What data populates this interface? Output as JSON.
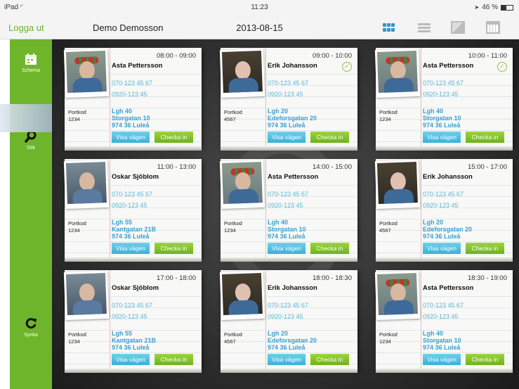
{
  "statusbar": {
    "device": "iPad",
    "wifi": "◜",
    "time": "11:23",
    "battery": "46 %",
    "battery_level": 0.46,
    "location": "➤"
  },
  "navbar": {
    "logout": "Logga ut",
    "user": "Demo Demosson",
    "date": "2013-08-15"
  },
  "sidebar": {
    "schema": "Schema",
    "search": "Sök",
    "sync": "Synka"
  },
  "colors": {
    "accent_green": "#6fb52c",
    "link_blue": "#3aa0cf",
    "route_btn": "#39b2d9",
    "checkin_btn": "#6db21f"
  },
  "cards": [
    {
      "time": "08:00 - 09:00",
      "name": "Asta Pettersson",
      "phone1": "070-123 45 67",
      "phone2": "0920-123 45",
      "portkod_label": "Portkod",
      "portkod": "1234",
      "apt": "Lgh 40",
      "street": "Storgatan 10",
      "city": "974 36 Luleå",
      "route": "Visa vägen",
      "checkin": "Checka in",
      "checked": false,
      "photo": "wreath"
    },
    {
      "time": "09:00 - 10:00",
      "name": "Erik Johansson",
      "phone1": "070-123 45 67",
      "phone2": "0920-123 45",
      "portkod_label": "Portkod",
      "portkod": "4567",
      "apt": "Lgh 20",
      "street": "Edeforsgatan 20",
      "city": "974 36 Luleå",
      "route": "Visa vägen",
      "checkin": "Checka in",
      "checked": true,
      "photo": "glasses"
    },
    {
      "time": "10:00 - 11:00",
      "name": "Asta Pettersson",
      "phone1": "070-123 45 67",
      "phone2": "0920-123 45",
      "portkod_label": "Portkod",
      "portkod": "1234",
      "apt": "Lgh 40",
      "street": "Storgatan 10",
      "city": "974 36 Luleå",
      "route": "Visa vägen",
      "checkin": "Checka in",
      "checked": true,
      "photo": "wreath"
    },
    {
      "time": "11:00 - 13:00",
      "name": "Oskar  Sjöblom",
      "phone1": "070-123 45 67",
      "phone2": "0920-123 45",
      "portkod_label": "Portkod",
      "portkod": "1234",
      "apt": "Lgh 55",
      "street": "Kantgatan 21B",
      "city": "974 36 Luleå",
      "route": "Visa vägen",
      "checkin": "Checka in",
      "checked": false,
      "photo": "blue"
    },
    {
      "time": "14:00 - 15:00",
      "name": "Asta Pettersson",
      "phone1": "070-123 45 67",
      "phone2": "0920-123 45",
      "portkod_label": "Portkod",
      "portkod": "1234",
      "apt": "Lgh 40",
      "street": "Storgatan 10",
      "city": "974 36 Luleå",
      "route": "Visa vägen",
      "checkin": "Checka in",
      "checked": false,
      "photo": "wreath"
    },
    {
      "time": "15:00 - 17:00",
      "name": "Erik Johansson",
      "phone1": "070-123 45 67",
      "phone2": "0920-123 45",
      "portkod_label": "Portkod",
      "portkod": "4567",
      "apt": "Lgh 20",
      "street": "Edeforsgatan 20",
      "city": "974 36 Luleå",
      "route": "Visa vägen",
      "checkin": "Checka in",
      "checked": false,
      "photo": "glasses"
    },
    {
      "time": "17:00 - 18:00",
      "name": "Oskar  Sjöblom",
      "phone1": "070-123 45 67",
      "phone2": "0920-123 45",
      "portkod_label": "Portkod",
      "portkod": "1234",
      "apt": "Lgh 55",
      "street": "Kantgatan 21B",
      "city": "974 36 Luleå",
      "route": "Visa vägen",
      "checkin": "Checka in",
      "checked": false,
      "photo": "blue"
    },
    {
      "time": "18:00 - 18:30",
      "name": "Erik Johansson",
      "phone1": "070-123 45 67",
      "phone2": "0920-123 45",
      "portkod_label": "Portkod",
      "portkod": "4567",
      "apt": "Lgh 20",
      "street": "Edeforsgatan 20",
      "city": "974 36 Luleå",
      "route": "Visa vägen",
      "checkin": "Checka in",
      "checked": false,
      "photo": "glasses"
    },
    {
      "time": "18:30 - 19:00",
      "name": "Asta Pettersson",
      "phone1": "070-123 45 67",
      "phone2": "0920-123 45",
      "portkod_label": "Portkod",
      "portkod": "1234",
      "apt": "Lgh 40",
      "street": "Storgatan 10",
      "city": "974 36 Luleå",
      "route": "Visa vägen",
      "checkin": "Checka in",
      "checked": false,
      "photo": "wreath"
    }
  ]
}
